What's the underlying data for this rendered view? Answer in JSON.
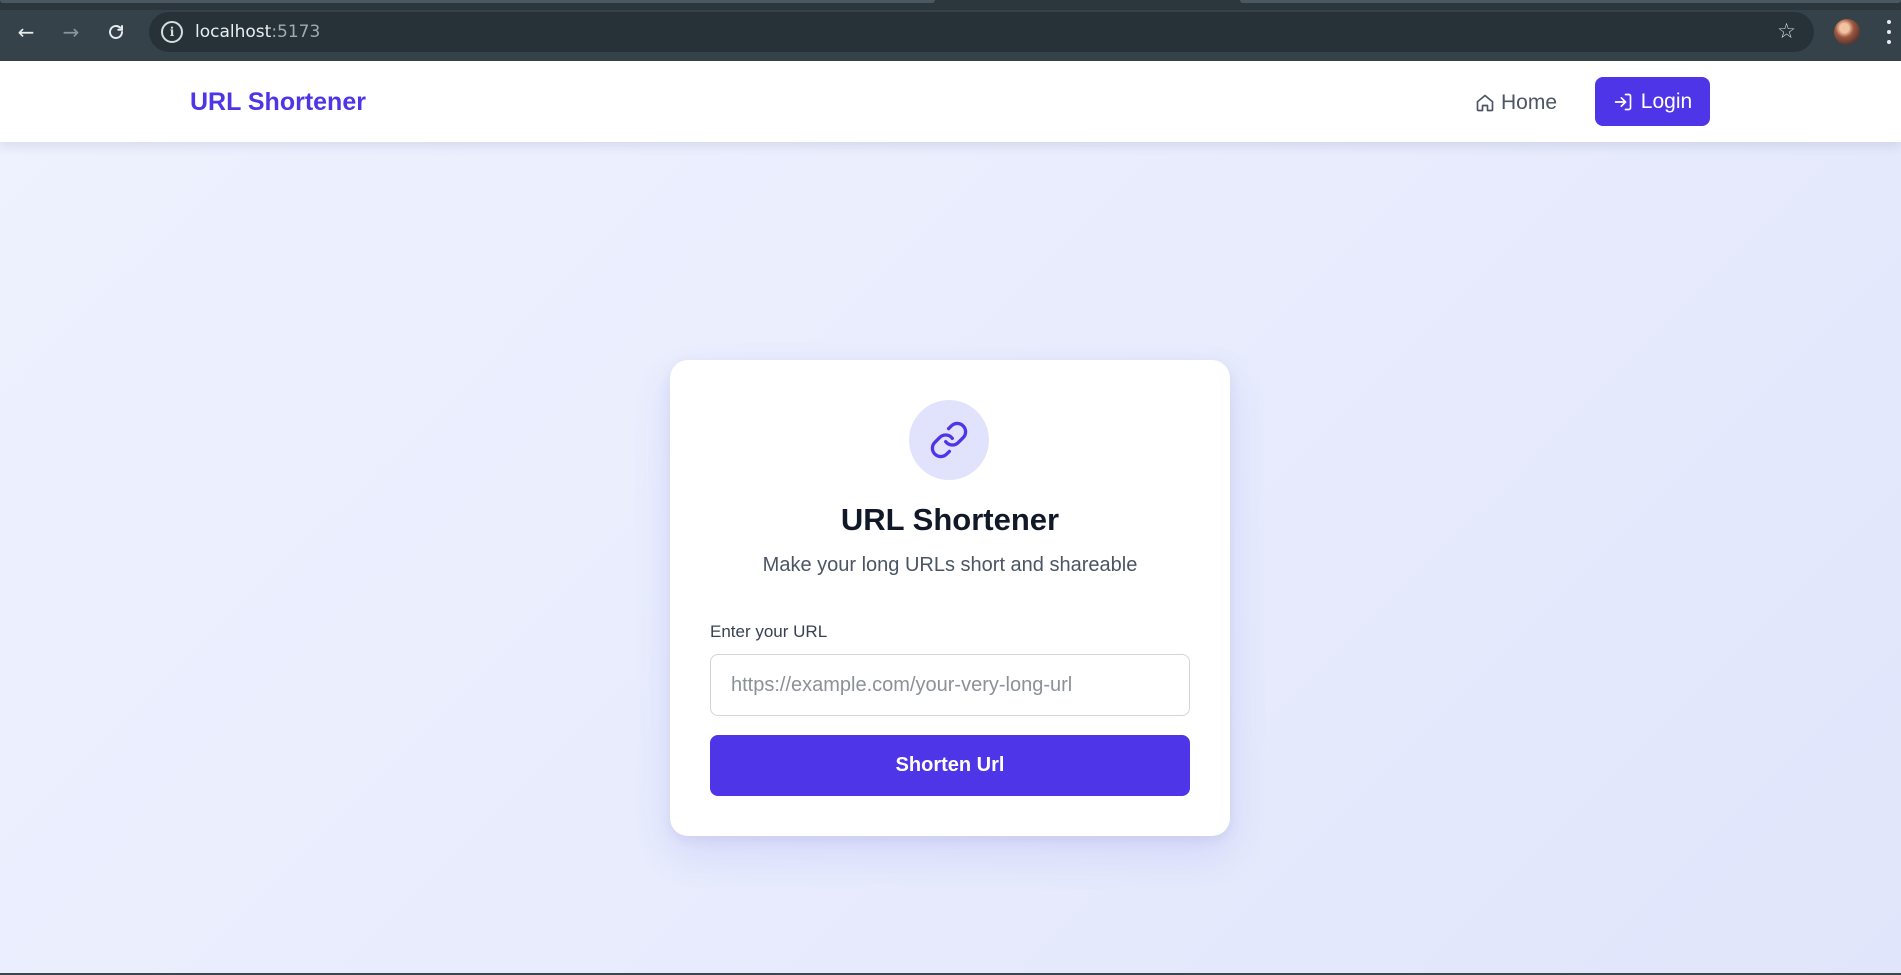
{
  "browser": {
    "url_host": "localhost",
    "url_port": ":5173",
    "back_icon": "arrow-left-icon",
    "forward_icon": "arrow-right-icon",
    "reload_icon": "reload-icon",
    "site_info_icon": "info-icon",
    "bookmark_icon": "star-icon",
    "menu_icon": "kebab-menu-icon"
  },
  "navbar": {
    "brand": "URL Shortener",
    "home_label": "Home",
    "login_label": "Login",
    "brand_color": "#4f35e8"
  },
  "card": {
    "title": "URL Shortener",
    "subtitle": "Make your long URLs short and shareable",
    "field_label": "Enter your URL",
    "input_value": "",
    "input_placeholder": "https://example.com/your-very-long-url",
    "button_label": "Shorten Url",
    "icon": "link-icon"
  }
}
